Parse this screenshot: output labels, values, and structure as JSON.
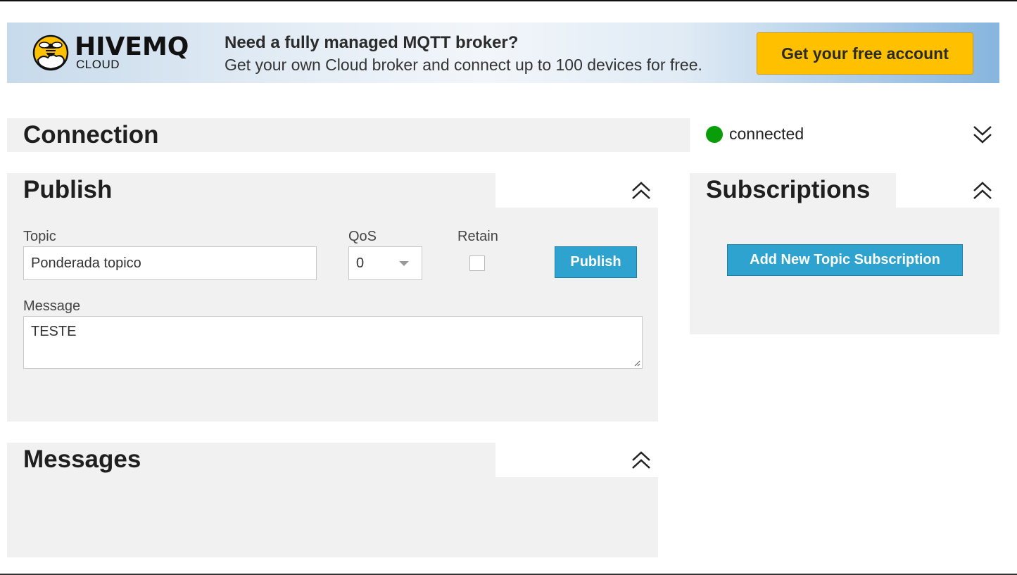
{
  "banner": {
    "logo_word": "HIVEMQ",
    "logo_sub": "CLOUD",
    "headline": "Need a fully managed MQTT broker?",
    "subline": "Get your own Cloud broker and connect up to 100 devices for free.",
    "cta_label": "Get your free account",
    "cta_color": "#ffc000"
  },
  "connection": {
    "title": "Connection",
    "status": "connected",
    "status_color": "#0a9d0a",
    "toggle_icon": "chevron-double-down-icon"
  },
  "publish": {
    "title": "Publish",
    "topic_label": "Topic",
    "topic_value": "Ponderada topico",
    "qos_label": "QoS",
    "qos_value": "0",
    "retain_label": "Retain",
    "retain_checked": false,
    "publish_label": "Publish",
    "message_label": "Message",
    "message_value": "TESTE",
    "toggle_icon": "chevron-double-up-icon"
  },
  "messages": {
    "title": "Messages",
    "toggle_icon": "chevron-double-up-icon"
  },
  "subscriptions": {
    "title": "Subscriptions",
    "add_label": "Add New Topic Subscription",
    "toggle_icon": "chevron-double-up-icon"
  },
  "colors": {
    "panel_bg": "#f1f1f1",
    "button_blue": "#2ea3cf"
  }
}
